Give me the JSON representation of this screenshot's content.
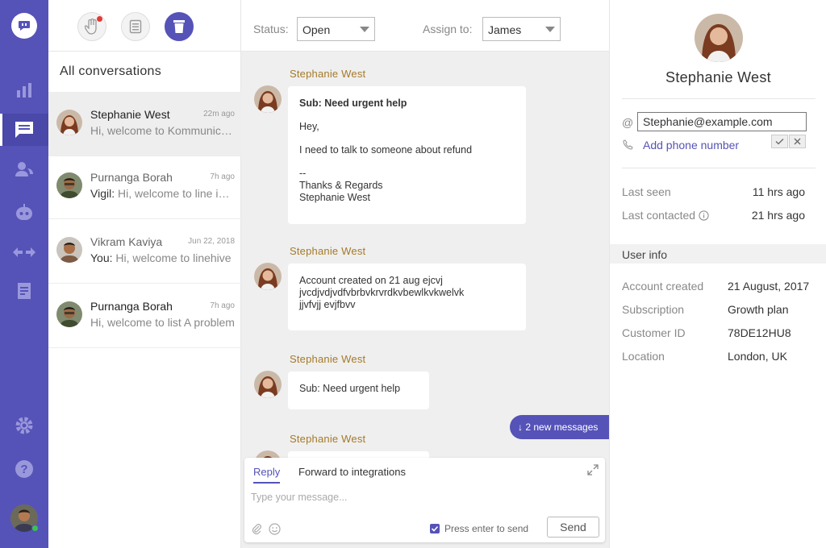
{
  "conversations_list": {
    "title": "All conversations",
    "items": [
      {
        "name": "Stephanie West",
        "time": "22m ago",
        "sender_prefix": "",
        "preview": "Hi, welcome to Kommunicate"
      },
      {
        "name": "Purnanga Borah",
        "time": "7h ago",
        "sender_prefix": "Vigil:",
        "preview": " Hi, welcome to line inbox"
      },
      {
        "name": "Vikram Kaviya",
        "time": "Jun 22, 2018",
        "sender_prefix": "You:",
        "preview": " Hi, welcome to linehive"
      },
      {
        "name": "Purnanga Borah",
        "time": "7h ago",
        "sender_prefix": "",
        "preview": "Hi, welcome to list A problem"
      }
    ]
  },
  "chat_header": {
    "status_label": "Status:",
    "status_value": "Open",
    "assign_label": "Assign to:",
    "assign_value": "James"
  },
  "messages": [
    {
      "sender": "Stephanie West",
      "subject": "Sub: Need urgent help",
      "lines": [
        "Hey,",
        "I need to talk to someone about refund",
        "--\nThanks & Regards\nStephanie West"
      ]
    },
    {
      "sender": "Stephanie West",
      "body": "Account created on 21 aug ejcvj\njvcdjvdjvdfvbrbvkrvrdkvbewlkvkwelvk\njjvfvjj evjfbvv"
    },
    {
      "sender": "Stephanie West",
      "body": "Sub: Need urgent help"
    },
    {
      "sender": "Stephanie West"
    }
  ],
  "new_messages_badge": "↓ 2 new messages",
  "reply_box": {
    "tab_reply": "Reply",
    "tab_forward": "Forward to integrations",
    "placeholder": "Type your message...",
    "enter_to_send": "Press enter to send",
    "send": "Send"
  },
  "user_panel": {
    "name": "Stephanie West",
    "email": "Stephanie@example.com",
    "add_phone": "Add phone number",
    "last_seen_label": "Last seen",
    "last_seen_value": "11 hrs ago",
    "last_contacted_label": "Last contacted",
    "last_contacted_value": "21 hrs ago",
    "info_title": "User info",
    "info": [
      {
        "label": "Account created",
        "value": "21 August, 2017"
      },
      {
        "label": "Subscription",
        "value": "Growth plan"
      },
      {
        "label": "Customer ID",
        "value": "78DE12HU8"
      },
      {
        "label": "Location",
        "value": "London, UK"
      }
    ]
  },
  "icons": {
    "nav": [
      "chat-logo-icon",
      "bar-chart-icon",
      "conversations-icon",
      "users-icon",
      "bot-icon",
      "integrations-icon",
      "knowledge-base-icon",
      "settings-icon",
      "help-icon"
    ],
    "filters": [
      "hand-icon",
      "notepad-icon",
      "archive-icon"
    ]
  },
  "colors": {
    "brand": "#5553b7",
    "sender": "#a57a2a",
    "online": "#3cc24f",
    "alert": "#e53935"
  }
}
